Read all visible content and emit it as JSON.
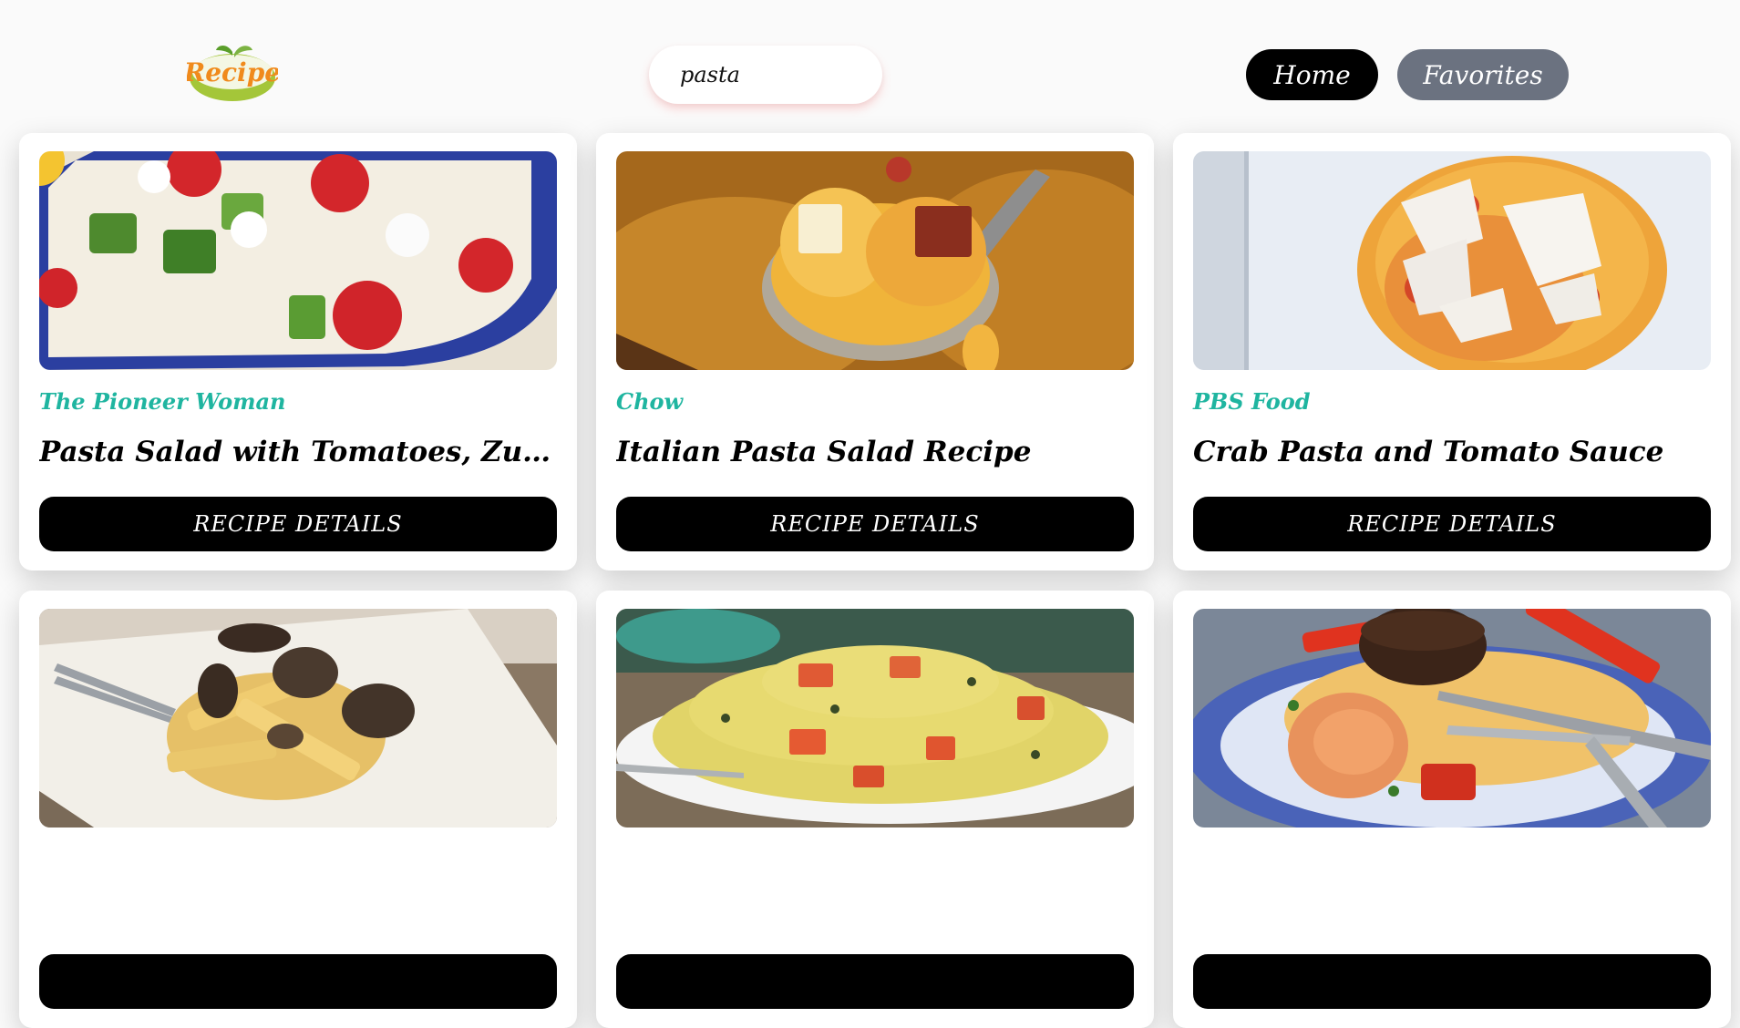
{
  "header": {
    "logo_text": "Recipe",
    "search": {
      "value": "pasta"
    },
    "nav": {
      "home": "Home",
      "favorites": "Favorites"
    }
  },
  "recipes": [
    {
      "source": "The Pioneer Woman",
      "title": "Pasta Salad with Tomatoes, Zucchini,...",
      "button": "RECIPE DETAILS"
    },
    {
      "source": "Chow",
      "title": "Italian Pasta Salad Recipe",
      "button": "RECIPE DETAILS"
    },
    {
      "source": "PBS Food",
      "title": "Crab Pasta and Tomato Sauce",
      "button": "RECIPE DETAILS"
    },
    {
      "source": "",
      "title": "",
      "button": ""
    },
    {
      "source": "",
      "title": "",
      "button": ""
    },
    {
      "source": "",
      "title": "",
      "button": ""
    }
  ],
  "colors": {
    "source_text": "#1fb5a0",
    "home_button": "#000000",
    "favorites_button": "#6b7280",
    "detail_button": "#000000"
  }
}
